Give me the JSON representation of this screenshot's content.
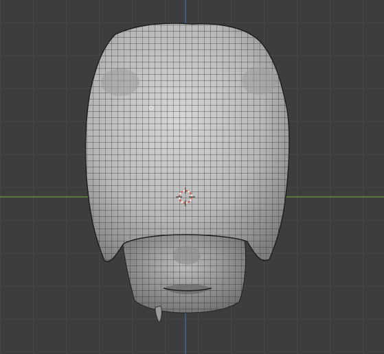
{
  "viewport": {
    "background_color": "#3d3d3d",
    "grid_color": "#4a4a4a",
    "x_axis_color": "#6f9a3c",
    "y_axis_color": "#3b6fb4"
  },
  "mesh": {
    "object": "head",
    "view": "top",
    "shading": "solid",
    "wireframe": "on",
    "surface_color": "#bdbdbd",
    "wire_color": "#2b2b2b"
  },
  "cursor": {
    "icon": "3d-cursor-icon",
    "color": "#d35b4a"
  }
}
